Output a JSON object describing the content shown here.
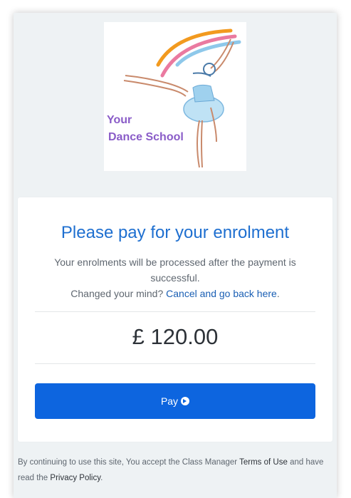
{
  "logo": {
    "line1": "Your",
    "line2": "Dance School"
  },
  "payment": {
    "title": "Please pay for your enrolment",
    "message_line1": "Your enrolments will be processed after the payment is successful.",
    "changed_mind": "Changed your mind?",
    "cancel_link": "Cancel and go back here",
    "cancel_suffix": ".",
    "amount": "£ 120.00",
    "pay_button": "Pay",
    "pay_icon": "arrow-circle-right-icon"
  },
  "footer": {
    "text1": "By continuing to use this site, You accept the Class Manager ",
    "terms_link": "Terms of Use",
    "text2": " and have read the ",
    "privacy_link": "Privacy Policy",
    "text3": "."
  },
  "colors": {
    "accent_blue": "#0d65df",
    "title_blue": "#1e6fd0",
    "background": "#eef2f4",
    "logo_purple": "#8a5cc8"
  }
}
